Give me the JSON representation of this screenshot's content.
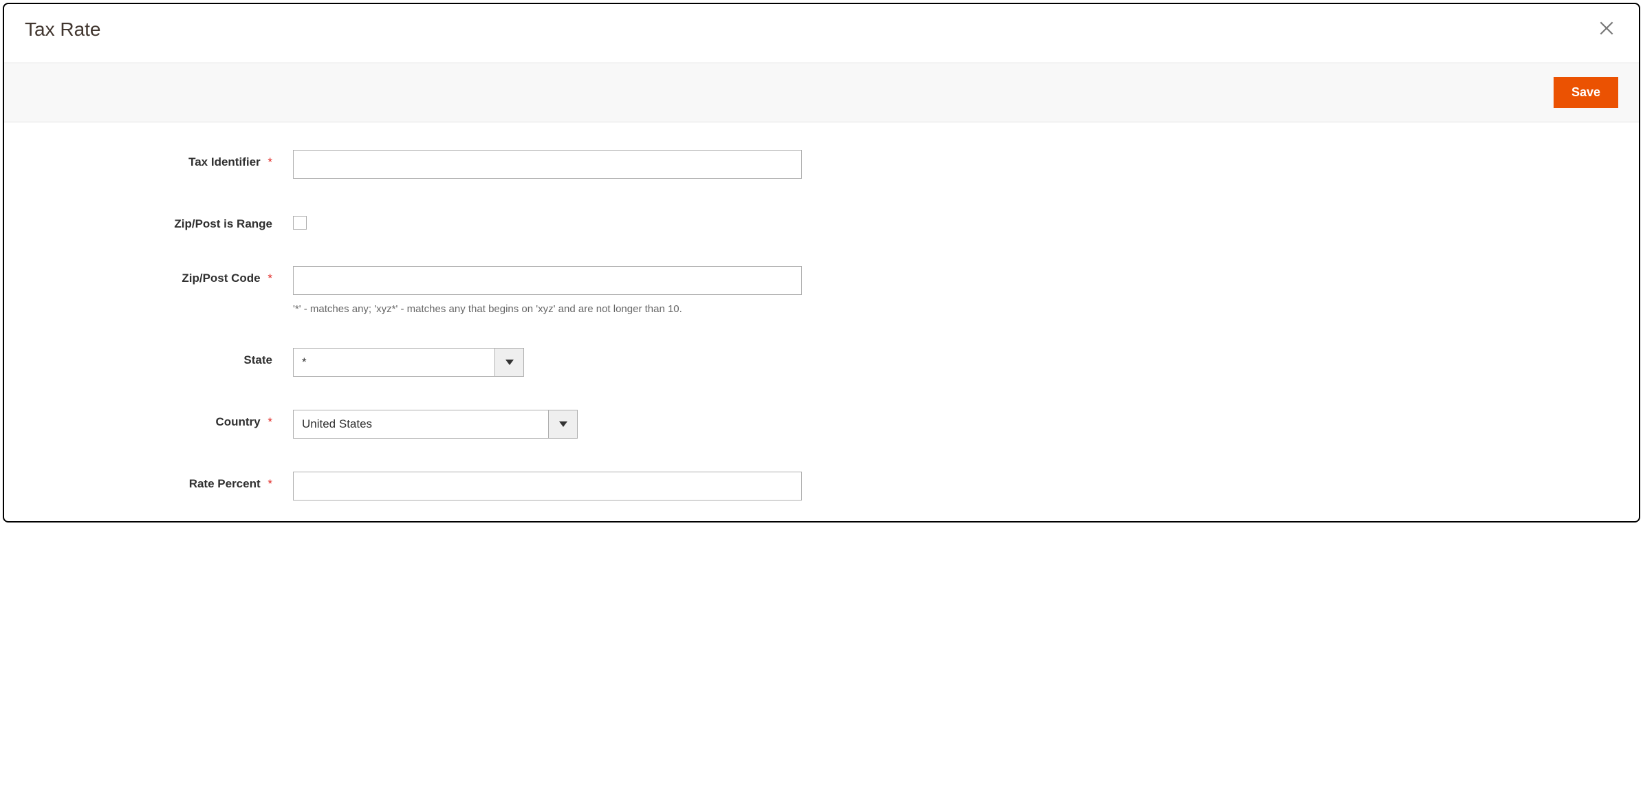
{
  "modal": {
    "title": "Tax Rate"
  },
  "toolbar": {
    "save_label": "Save"
  },
  "form": {
    "tax_identifier": {
      "label": "Tax Identifier",
      "required": true,
      "value": ""
    },
    "zip_is_range": {
      "label": "Zip/Post is Range",
      "required": false,
      "checked": false
    },
    "zip_code": {
      "label": "Zip/Post Code",
      "required": true,
      "value": "",
      "hint": "'*' - matches any; 'xyz*' - matches any that begins on 'xyz' and are not longer than 10."
    },
    "state": {
      "label": "State",
      "required": false,
      "value": "*"
    },
    "country": {
      "label": "Country",
      "required": true,
      "value": "United States"
    },
    "rate_percent": {
      "label": "Rate Percent",
      "required": true,
      "value": ""
    }
  },
  "required_mark": "*"
}
